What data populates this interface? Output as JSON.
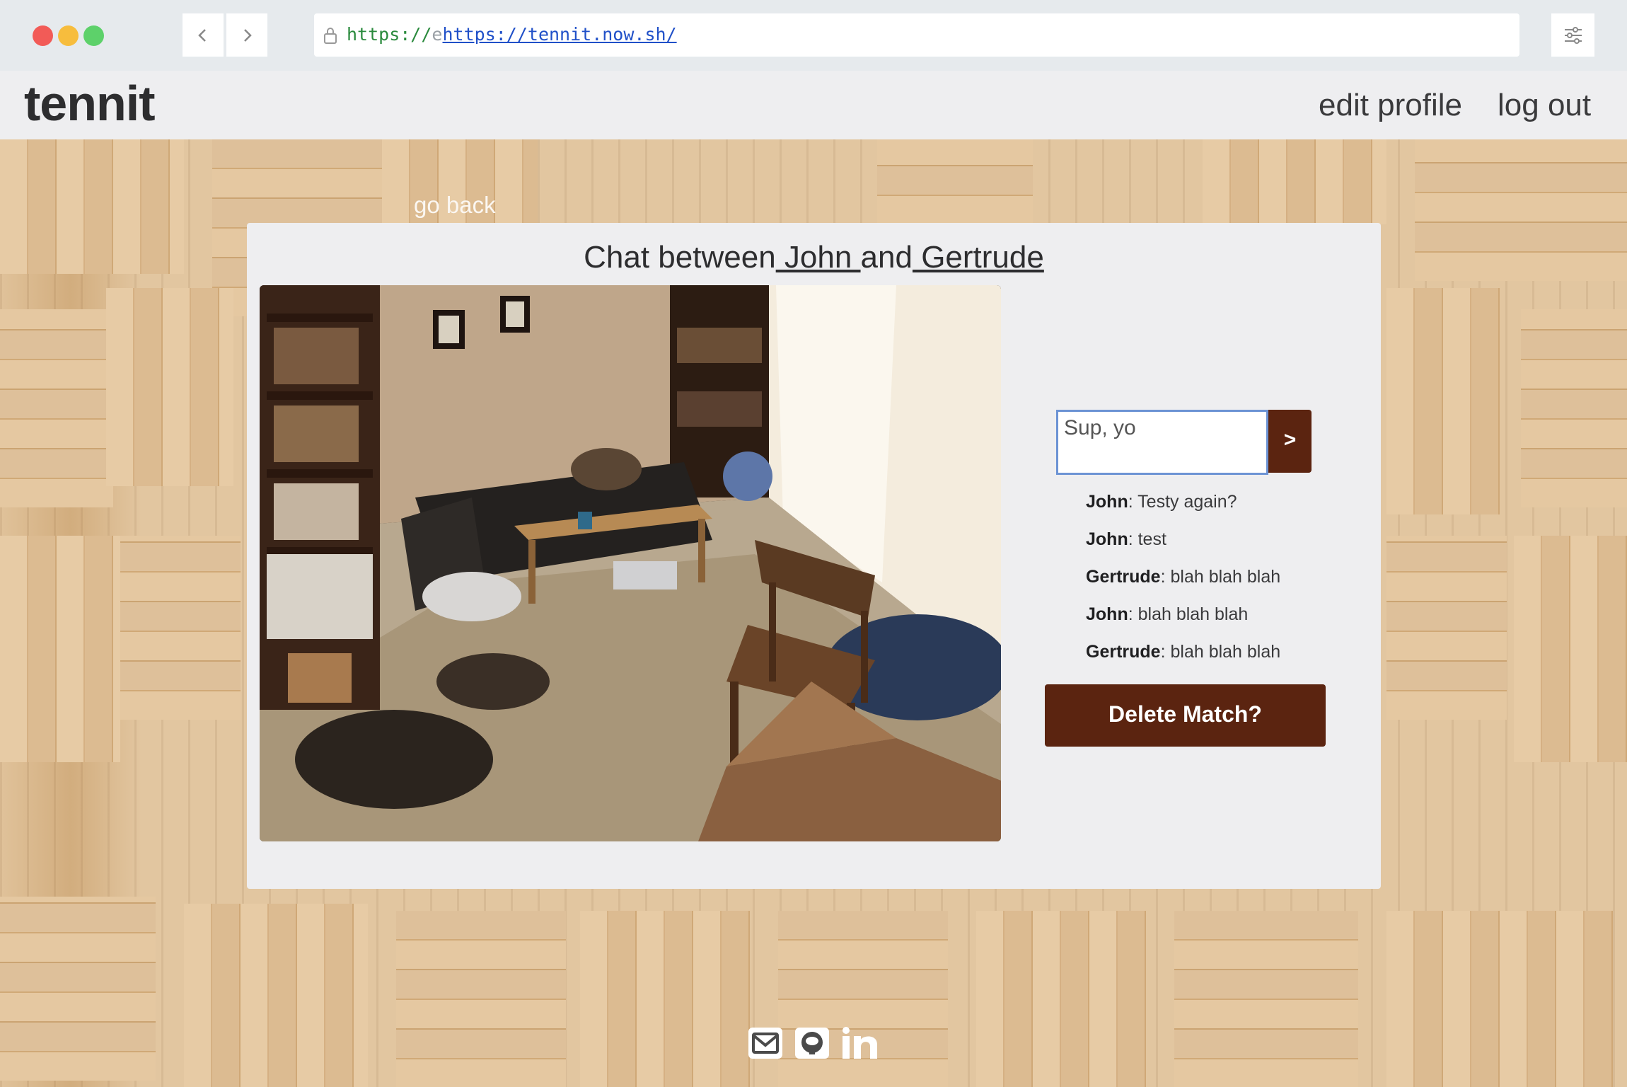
{
  "browser": {
    "url_prefix": "https://",
    "url_cut": "e",
    "url_link": "https://tennit.now.sh/"
  },
  "header": {
    "logo": "tennit",
    "nav": {
      "edit_profile": "edit profile",
      "log_out": "log out"
    }
  },
  "main": {
    "go_back": "go back",
    "title_prefix": "Chat between",
    "user_a": " John ",
    "title_and": "and",
    "user_b": " Gertrude",
    "photo_icon": "room-photo",
    "message_input": "Sup, yo",
    "send_label": ">",
    "messages": [
      {
        "name": "John",
        "text": ": Testy again?"
      },
      {
        "name": "John",
        "text": ": test"
      },
      {
        "name": "Gertrude",
        "text": ": blah blah blah"
      },
      {
        "name": "John",
        "text": ": blah blah blah"
      },
      {
        "name": "Gertrude",
        "text": ": blah blah blah"
      }
    ],
    "delete_label": "Delete Match?"
  },
  "footer": {
    "icons": [
      "mail-icon",
      "github-icon",
      "linkedin-icon"
    ]
  },
  "colors": {
    "accent": "#5b2410",
    "card": "#eeeef0",
    "input_border": "#6c93d4"
  }
}
